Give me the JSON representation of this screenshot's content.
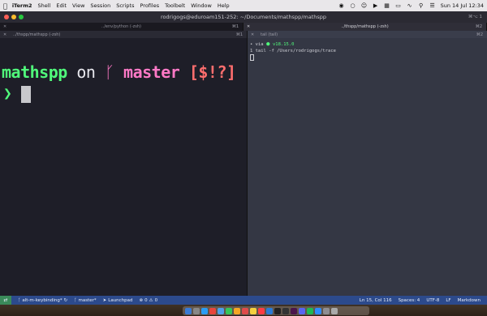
{
  "menubar": {
    "apple_icon": "apple-icon",
    "app_name": "iTerm2",
    "items": [
      "Shell",
      "Edit",
      "View",
      "Session",
      "Scripts",
      "Profiles",
      "Toolbelt",
      "Window",
      "Help"
    ],
    "status_icons": [
      "record-icon",
      "circle-icon",
      "face-icon",
      "play-icon",
      "grid-icon",
      "battery-icon",
      "wifi-icon",
      "search-icon",
      "control-center-icon"
    ],
    "clock": "Sun 14 Jul  12:34"
  },
  "window": {
    "title": "rodrigogs@eduroam151-252: ~/Documents/mathspp/mathspp",
    "title_shortcut": "⌘⌥ 1"
  },
  "tabs": [
    {
      "label": "../env/python (-zsh)",
      "shortcut": "⌘1",
      "active": false
    },
    {
      "label": "../thspp/mathspp (-zsh)",
      "shortcut": "⌘2",
      "active": true
    }
  ],
  "left_pane": {
    "title": "../thspp/mathspp (-zsh)",
    "shortcut": "⌘1",
    "prompt": {
      "dir": "mathspp",
      "on": "on",
      "branch_icon": "ᚴ",
      "branch": "master",
      "status": "[$!?]",
      "symbol": "❯"
    }
  },
  "right_pane": {
    "title": "tail (tail)",
    "shortcut": "⌘2",
    "lines": {
      "l1_prefix": "• via",
      "l1_icon": "⬢",
      "l1_version": "v18.15.0",
      "l2": "1 tail -f /Users/rodrigogs/trace"
    }
  },
  "statusbar": {
    "remote_icon": "remote-icon",
    "branch_text": "alt-m-keybinding*",
    "sync_icon": "sync-icon",
    "git_branch": "master*",
    "launchpad": "Launchpad",
    "problems": "0",
    "warnings": "0",
    "right_items": [
      "Ln 15, Col 116",
      "Spaces: 4",
      "UTF-8",
      "LF",
      "Markdown"
    ],
    "colors": {
      "bg": "#2c4a8c",
      "remote": "#3a8a5a"
    }
  },
  "dock": {
    "icons": [
      "finder-icon",
      "launchpad-icon",
      "safari-icon",
      "chrome-icon",
      "mail-icon",
      "messages-icon",
      "photos-icon",
      "calendar-icon",
      "notes-icon",
      "music-icon",
      "vscode-icon",
      "iterm-icon",
      "terminal-icon",
      "slack-icon",
      "discord-icon",
      "spotify-icon",
      "zoom-icon",
      "settings-icon",
      "trash-icon"
    ],
    "colors": [
      "#3a7bd5",
      "#888888",
      "#2a9df4",
      "#e8453c",
      "#4ea0e8",
      "#34c759",
      "#f5a623",
      "#e04b4b",
      "#f4d03f",
      "#fc3c44",
      "#2b7bd6",
      "#222222",
      "#333333",
      "#4a154b",
      "#5865f2",
      "#1db954",
      "#2d8cff",
      "#8e8e93",
      "#aaaaaa"
    ]
  }
}
